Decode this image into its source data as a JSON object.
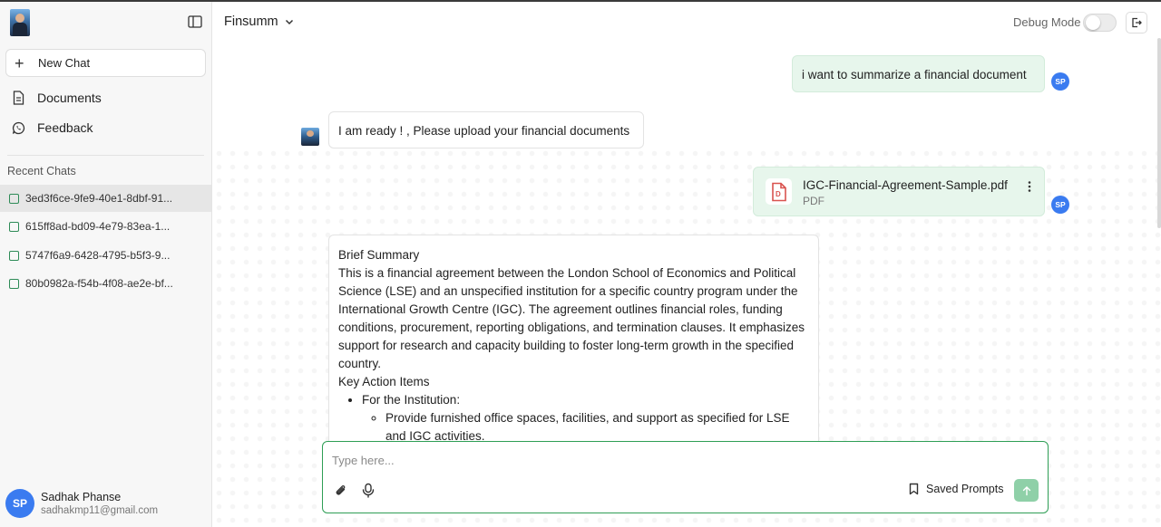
{
  "sidebar": {
    "new_chat_label": "New Chat",
    "nav": [
      {
        "label": "Documents",
        "icon": "document-icon"
      },
      {
        "label": "Feedback",
        "icon": "feedback-icon"
      }
    ],
    "recent_title": "Recent Chats",
    "recent_chats": [
      {
        "label": "3ed3f6ce-9fe9-40e1-8dbf-91...",
        "active": true
      },
      {
        "label": "615ff8ad-bd09-4e79-83ea-1...",
        "active": false
      },
      {
        "label": "5747f6a9-6428-4795-b5f3-9...",
        "active": false
      },
      {
        "label": "80b0982a-f54b-4f08-ae2e-bf...",
        "active": false
      }
    ],
    "user": {
      "initials": "SP",
      "name": "Sadhak Phanse",
      "email": "sadhakmp11@gmail.com"
    }
  },
  "header": {
    "model_name": "Finsumm",
    "debug_label": "Debug Mode",
    "debug_on": false
  },
  "chat": {
    "user_initials": "SP",
    "msg1": "i want to summarize a financial document",
    "msg2": "I am ready ! , Please upload your financial documents",
    "file": {
      "name": "IGC-Financial-Agreement-Sample.pdf",
      "type": "PDF"
    },
    "summary": {
      "heading": "Brief Summary",
      "paragraph": "This is a financial agreement between the London School of Economics and Political Science (LSE) and an unspecified institution for a specific country program under the International Growth Centre (IGC). The agreement outlines financial roles, funding conditions, procurement, reporting obligations, and termination clauses. It emphasizes support for research and capacity building to foster long-term growth in the specified country.",
      "actions_heading": "Key Action Items",
      "action_group": "For the Institution",
      "action_group_suffix": ":",
      "action_item": "Provide furnished office spaces, facilities, and support as specified for LSE and IGC activities."
    }
  },
  "composer": {
    "placeholder": "Type here...",
    "saved_prompts_label": "Saved Prompts"
  },
  "colors": {
    "accent_green": "#2e9e55",
    "user_bubble": "#e7f6ec",
    "avatar_blue": "#3a7bf0"
  }
}
